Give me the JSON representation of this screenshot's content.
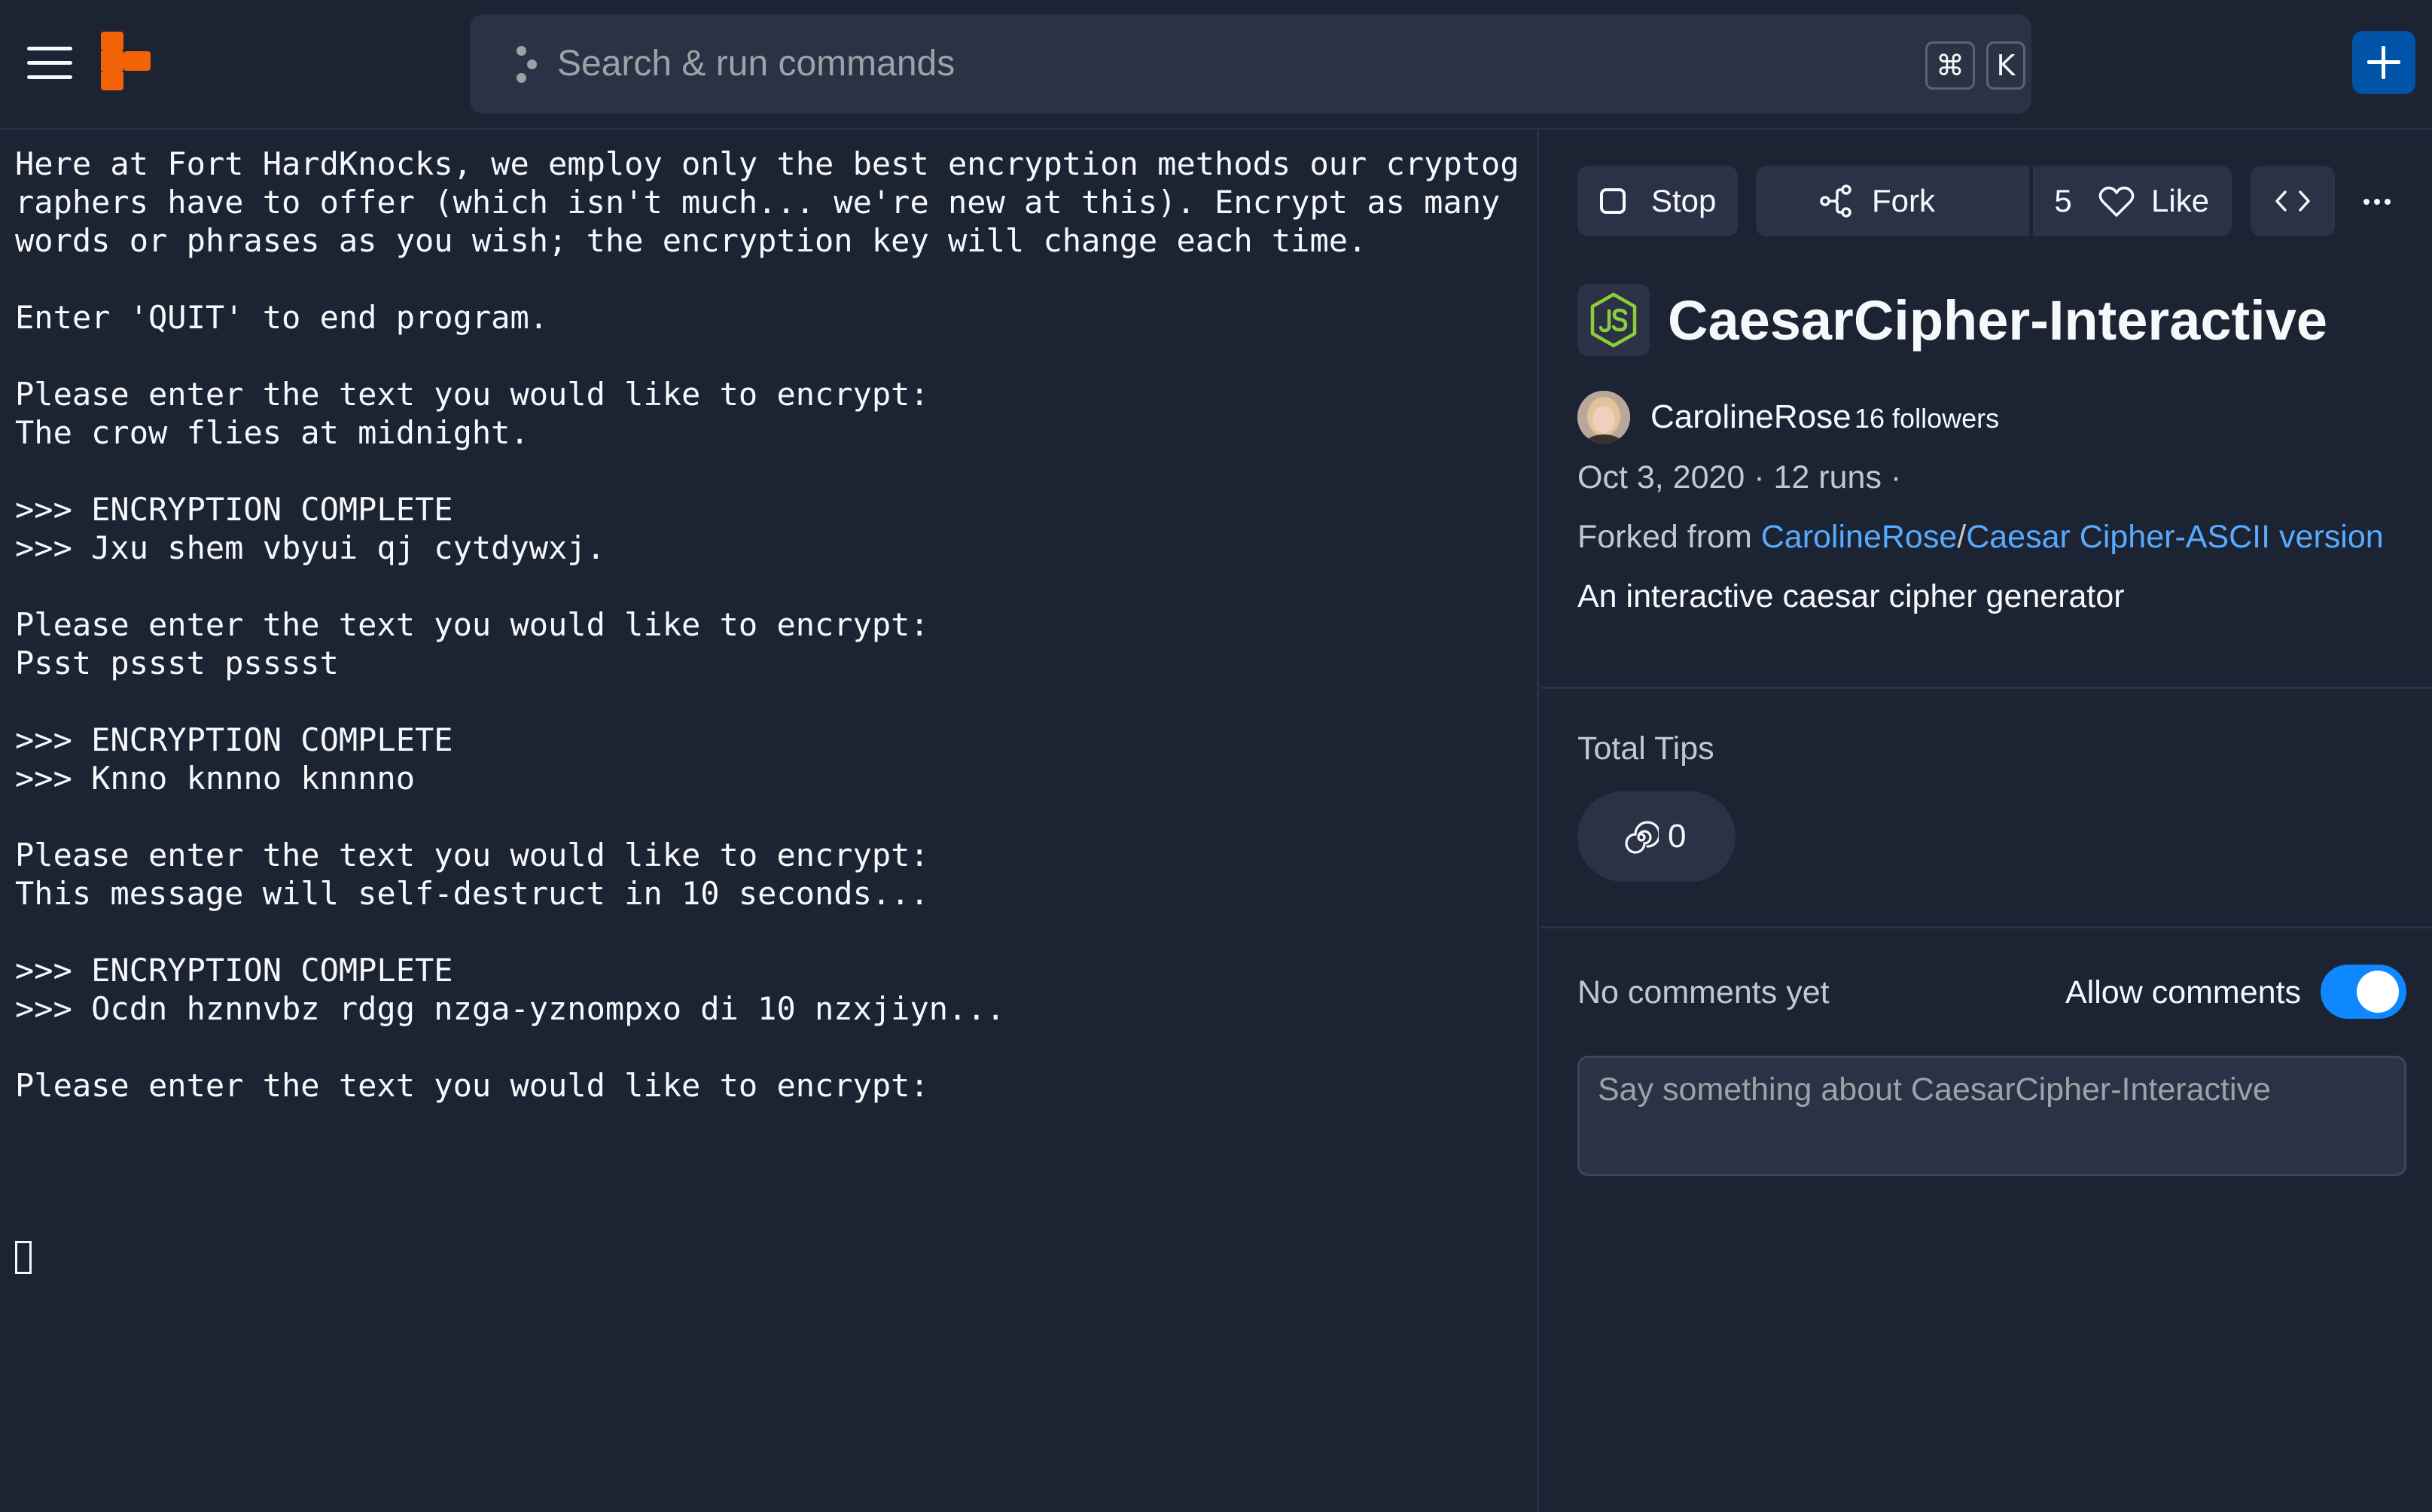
{
  "search": {
    "placeholder": "Search & run commands",
    "shortcut_cmd": "⌘",
    "shortcut_key": "K"
  },
  "console": {
    "lines": [
      "Here at Fort HardKnocks, we employ only the best encryption methods our cryptog",
      "raphers have to offer (which isn't much... we're new at this). Encrypt as many",
      "words or phrases as you wish; the encryption key will change each time.",
      "",
      "Enter 'QUIT' to end program.",
      "",
      "Please enter the text you would like to encrypt:",
      "The crow flies at midnight.",
      "",
      ">>> ENCRYPTION COMPLETE",
      ">>> Jxu shem vbyui qj cytdywxj.",
      "",
      "Please enter the text you would like to encrypt:",
      "Psst pssst psssst",
      "",
      ">>> ENCRYPTION COMPLETE",
      ">>> Knno knnno knnnno",
      "",
      "Please enter the text you would like to encrypt:",
      "This message will self-destruct in 10 seconds...",
      "",
      ">>> ENCRYPTION COMPLETE",
      ">>> Ocdn hznnvbz rdgg nzga-yznompxo di 10 nzxjiyn...",
      "",
      "Please enter the text you would like to encrypt:"
    ]
  },
  "actions": {
    "stop_label": "Stop",
    "fork_label": "Fork",
    "fork_count": "5",
    "like_label": "Like"
  },
  "repl": {
    "title": "CaesarCipher-Interactive",
    "author": "CarolineRose",
    "followers": "16 followers",
    "meta": "Oct 3, 2020 · 12 runs ·",
    "forked_prefix": "Forked from",
    "forked_user": "CarolineRose",
    "forked_sep": "/",
    "forked_repl": "Caesar Cipher-ASCII version",
    "description": "An interactive caesar cipher generator"
  },
  "tips": {
    "label": "Total Tips",
    "count": "0"
  },
  "comments": {
    "empty_text": "No comments yet",
    "allow_label": "Allow comments",
    "allow_enabled": true,
    "placeholder": "Say something about CaesarCipher-Interactive"
  },
  "colors": {
    "background": "#1c2333",
    "surface": "#2b3245",
    "link": "#57abff",
    "toggle_on": "#0f87ff",
    "brand_orange": "#f26207",
    "node_green": "#8ccc3d"
  }
}
